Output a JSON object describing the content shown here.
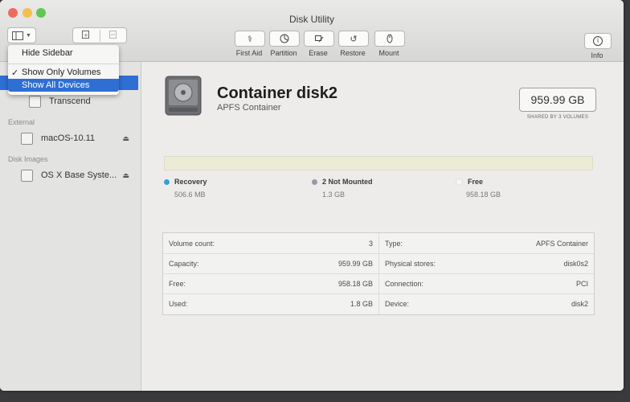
{
  "window": {
    "title": "Disk Utility"
  },
  "colors": {
    "close": "#ef6a5e",
    "minimize": "#f5bf4f",
    "zoom": "#62c554",
    "selection": "#2f6fd4",
    "recovery": "#2fa3d6",
    "not_mounted": "#9a9aa6",
    "free": "#f6f6f2"
  },
  "toolbar": {
    "buttons": [
      {
        "label": "First Aid",
        "icon": "stethoscope-icon"
      },
      {
        "label": "Partition",
        "icon": "pie-icon"
      },
      {
        "label": "Erase",
        "icon": "eraser-icon"
      },
      {
        "label": "Restore",
        "icon": "restore-icon"
      },
      {
        "label": "Mount",
        "icon": "mount-icon"
      }
    ],
    "info": {
      "label": "Info",
      "icon": "info-icon"
    }
  },
  "menu": {
    "items": [
      {
        "label": "Hide Sidebar",
        "checked": false,
        "highlighted": false
      },
      {
        "label": "Show Only Volumes",
        "checked": true,
        "highlighted": false
      },
      {
        "label": "Show All Devices",
        "checked": false,
        "highlighted": true
      }
    ],
    "check": "✓"
  },
  "sidebar": {
    "internal_item": "Transcend",
    "sections": [
      {
        "title": "External",
        "items": [
          {
            "label": "macOS-10.11",
            "eject": true
          }
        ]
      },
      {
        "title": "Disk Images",
        "items": [
          {
            "label": "OS X Base Syste...",
            "eject": true
          }
        ]
      }
    ]
  },
  "disk": {
    "name": "Container disk2",
    "subtitle": "APFS Container",
    "size": "959.99 GB",
    "size_caption": "SHARED BY 3 VOLUMES"
  },
  "legend": [
    {
      "name": "Recovery",
      "value": "506.6 MB"
    },
    {
      "name": "2 Not Mounted",
      "value": "1.3 GB"
    },
    {
      "name": "Free",
      "value": "958.18 GB"
    }
  ],
  "info": {
    "left": [
      {
        "key": "Volume count:",
        "value": "3"
      },
      {
        "key": "Capacity:",
        "value": "959.99 GB"
      },
      {
        "key": "Free:",
        "value": "958.18 GB"
      },
      {
        "key": "Used:",
        "value": "1.8 GB"
      }
    ],
    "right": [
      {
        "key": "Type:",
        "value": "APFS Container"
      },
      {
        "key": "Physical stores:",
        "value": "disk0s2"
      },
      {
        "key": "Connection:",
        "value": "PCI"
      },
      {
        "key": "Device:",
        "value": "disk2"
      }
    ]
  }
}
